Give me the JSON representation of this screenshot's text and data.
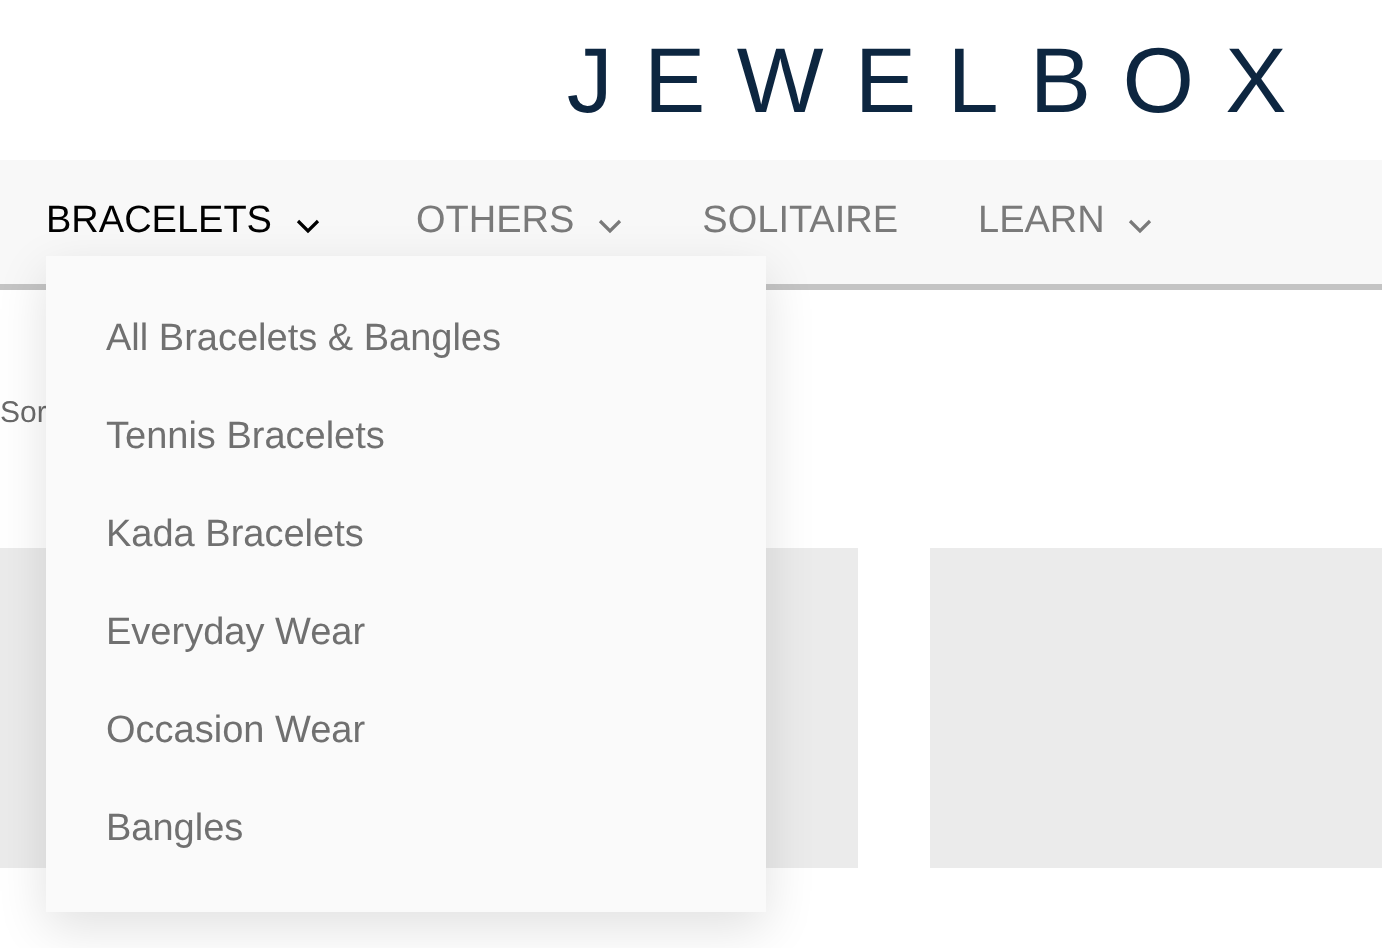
{
  "logo": "JEWELBOX",
  "nav": [
    {
      "label": "BRACELETS",
      "selected": true,
      "has_menu": true
    },
    {
      "label": "OTHERS",
      "selected": false,
      "has_menu": true
    },
    {
      "label": "SOLITAIRE",
      "selected": false,
      "has_menu": false
    },
    {
      "label": "LEARN",
      "selected": false,
      "has_menu": true
    }
  ],
  "dropdown": [
    "All Bracelets & Bangles",
    "Tennis Bracelets",
    "Kada Bracelets",
    "Everyday Wear",
    "Occasion Wear",
    "Bangles"
  ],
  "sort_label": "Sor"
}
